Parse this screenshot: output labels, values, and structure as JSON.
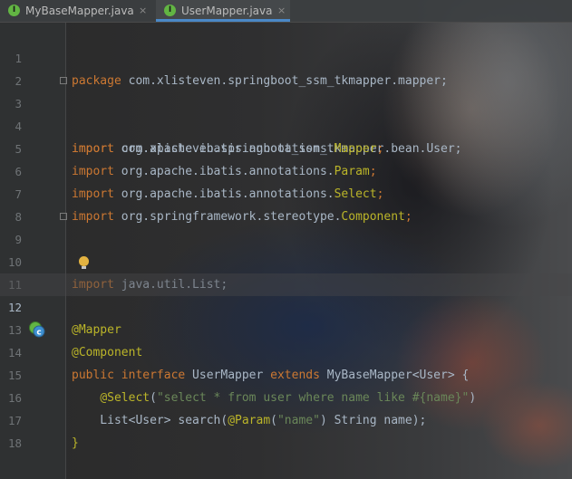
{
  "tabs": [
    {
      "label": "MyBaseMapper.java",
      "icon": "interface-icon",
      "icon_letter": "I"
    },
    {
      "label": "UserMapper.java",
      "icon": "interface-icon",
      "icon_letter": "I",
      "active": true
    }
  ],
  "tab_close_glyph": "×",
  "editor": {
    "current_line": 12,
    "lines": [
      {
        "n": "1"
      },
      {
        "n": "2"
      },
      {
        "n": "3"
      },
      {
        "n": "4"
      },
      {
        "n": "5"
      },
      {
        "n": "6"
      },
      {
        "n": "7"
      },
      {
        "n": "8"
      },
      {
        "n": "9"
      },
      {
        "n": "10"
      },
      {
        "n": "11"
      },
      {
        "n": "12"
      },
      {
        "n": "13"
      },
      {
        "n": "14"
      },
      {
        "n": "15"
      },
      {
        "n": "16"
      },
      {
        "n": "17"
      },
      {
        "n": "18"
      }
    ],
    "code": {
      "l1_kw": "package",
      "l1_rest": " com.xlisteven.springboot_ssm_tkmapper.mapper;",
      "l3_kw": "import",
      "l3_rest": " com.xlisteven.springboot_ssm_tkmapper.bean.User;",
      "l4_kw": "import",
      "l4_pkg": " org.apache.ibatis.annotations.",
      "l4_cls": "Mapper",
      "l4_end": ";",
      "l5_kw": "import",
      "l5_pkg": " org.apache.ibatis.annotations.",
      "l5_cls": "Param",
      "l5_end": ";",
      "l6_kw": "import",
      "l6_pkg": " org.apache.ibatis.annotations.",
      "l6_cls": "Select",
      "l6_end": ";",
      "l7_kw": "import",
      "l7_pkg": " org.springframework.stereotype.",
      "l7_cls": "Component",
      "l7_end": ";",
      "l9_kw": "import",
      "l9_rest": " java.util.List;",
      "l12_ann": "@Mapper",
      "l13_ann": "@Component",
      "l14_kw1": "public interface",
      "l14_name": " UserMapper ",
      "l14_kw2": "extends",
      "l14_rest": " MyBaseMapper<User> {",
      "l15_indent": "    ",
      "l15_ann": "@Select",
      "l15_open": "(",
      "l15_str": "\"select * from user where name like #{name}\"",
      "l15_close": ")",
      "l16_a": "    List<User> search(",
      "l16_ann": "@Param",
      "l16_open": "(",
      "l16_str": "\"name\"",
      "l16_rest": ") String name);",
      "l17": "}"
    }
  },
  "gutter_icons": {
    "line11": "lightbulb-icon",
    "line14": "implemented-interface-icon"
  },
  "colors": {
    "keyword": "#cc7832",
    "annotation": "#bbb529",
    "string": "#6a8759",
    "plain": "#a9b7c6",
    "line_number": "#6f7376",
    "tab_underline": "#4a88c7",
    "interface_icon": "#62b543"
  }
}
